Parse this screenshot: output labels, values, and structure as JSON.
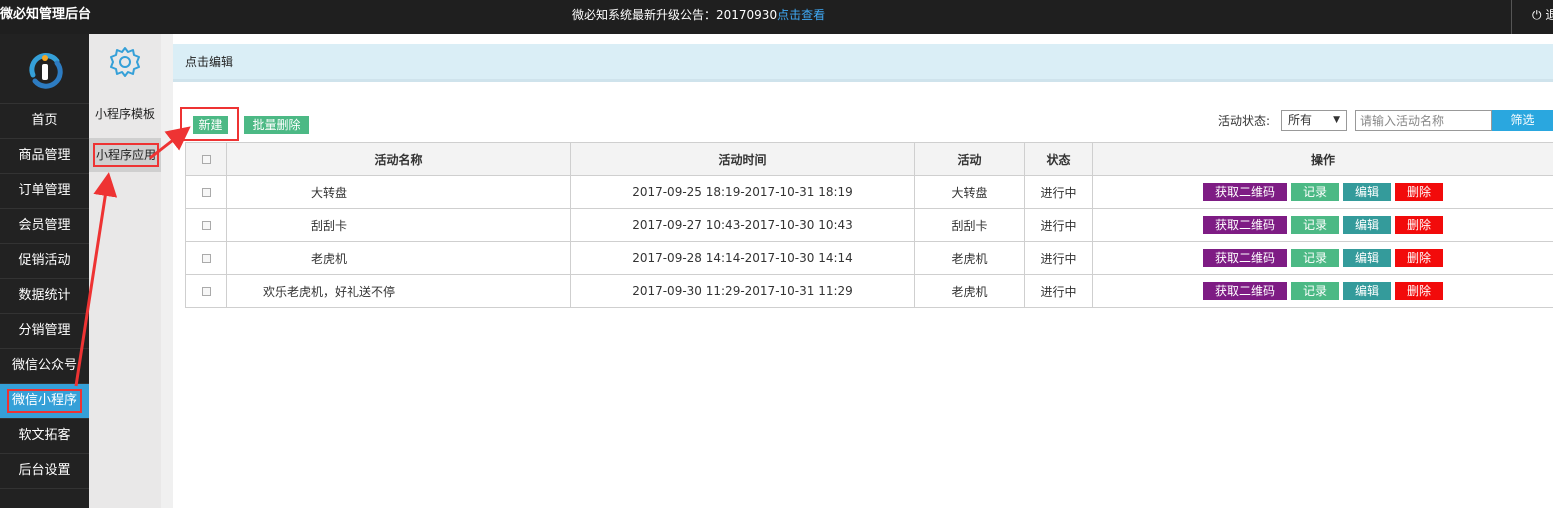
{
  "topbar": {
    "brand": "微必知管理后台",
    "notice_text": "微必知系统最新升级公告：20170930",
    "notice_link": "点击查看",
    "right_label": "退出"
  },
  "nav": {
    "items": [
      {
        "label": "首页"
      },
      {
        "label": "商品管理"
      },
      {
        "label": "订单管理"
      },
      {
        "label": "会员管理"
      },
      {
        "label": "促销活动"
      },
      {
        "label": "数据统计"
      },
      {
        "label": "分销管理"
      },
      {
        "label": "微信公众号"
      },
      {
        "label": "微信小程序"
      },
      {
        "label": "软文拓客"
      },
      {
        "label": "后台设置"
      }
    ]
  },
  "subnav": {
    "items": [
      {
        "label": "小程序模板"
      },
      {
        "label": "小程序应用"
      }
    ]
  },
  "breadcrumb": "点击编辑",
  "toolbar": {
    "new_label": "新建",
    "batch_delete_label": "批量删除",
    "status_label": "活动状态:",
    "status_value": "所有",
    "search_placeholder": "请输入活动名称",
    "filter_label": "筛选"
  },
  "table": {
    "headers": {
      "name": "活动名称",
      "time": "活动时间",
      "activity": "活动",
      "status": "状态",
      "ops": "操作"
    },
    "rows": [
      {
        "name": "大转盘",
        "time": "2017-09-25 18:19-2017-10-31 18:19",
        "activity": "大转盘",
        "status": "进行中"
      },
      {
        "name": "刮刮卡",
        "time": "2017-09-27 10:43-2017-10-30 10:43",
        "activity": "刮刮卡",
        "status": "进行中"
      },
      {
        "name": "老虎机",
        "time": "2017-09-28 14:14-2017-10-30 14:14",
        "activity": "老虎机",
        "status": "进行中"
      },
      {
        "name": "欢乐老虎机，好礼送不停",
        "time": "2017-09-30 11:29-2017-10-31 11:29",
        "activity": "老虎机",
        "status": "进行中"
      }
    ],
    "op_labels": {
      "qr": "获取二维码",
      "record": "记录",
      "edit": "编辑",
      "delete": "删除"
    }
  },
  "colors": {
    "accent": "#35a0d8",
    "annotation": "#ee3333",
    "green": "#4cb985",
    "purple": "#7e1c84",
    "teal": "#349b9b",
    "red": "#f20b0b"
  }
}
